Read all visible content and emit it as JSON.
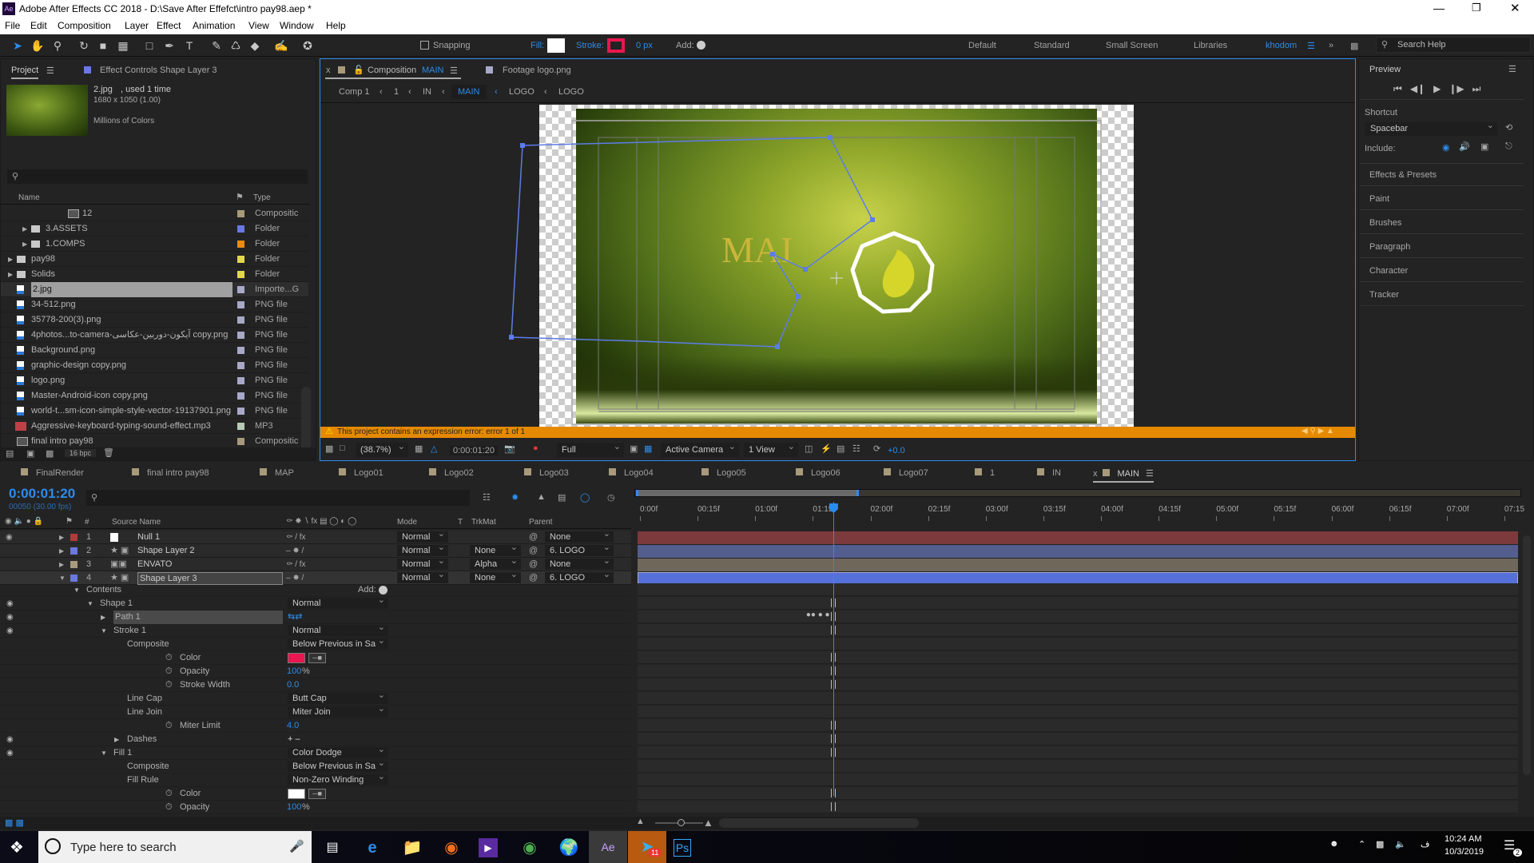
{
  "window": {
    "title": "Adobe After Effects CC 2018 - D:\\Save After Effefct\\intro pay98.aep *",
    "app_icon": "Ae"
  },
  "menu": [
    "File",
    "Edit",
    "Composition",
    "Layer",
    "Effect",
    "Animation",
    "View",
    "Window",
    "Help"
  ],
  "toolbar": {
    "snapping": "Snapping",
    "fill": "Fill:",
    "stroke": "Stroke:",
    "stroke_px": "0 px",
    "add": "Add:",
    "workspaces": [
      "Default",
      "Standard",
      "Small Screen",
      "Libraries",
      "khodom"
    ],
    "search_placeholder": "Search Help",
    "fill_color": "#ffffff",
    "stroke_color": "#e8174f"
  },
  "project": {
    "tab": "Project",
    "tab2": "Effect Controls Shape Layer 3",
    "preview": {
      "name": "2.jpg",
      "used": ", used 1 time",
      "size": "1680 x 1050 (1.00)",
      "colors": "Millions of Colors"
    },
    "col_name": "Name",
    "col_type": "Type",
    "bpc": "16 bpc",
    "items": [
      {
        "name": "12",
        "type": "Compositic",
        "label": "#a99a7c",
        "kind": "comp",
        "indent": 2
      },
      {
        "name": "3.ASSETS",
        "type": "Folder",
        "label": "#6a78e0",
        "kind": "folder",
        "indent": 1
      },
      {
        "name": "1.COMPS",
        "type": "Folder",
        "label": "#ee8a10",
        "kind": "folder",
        "indent": 1
      },
      {
        "name": "pay98",
        "type": "Folder",
        "label": "#e3d84a",
        "kind": "folder",
        "indent": 0
      },
      {
        "name": "Solids",
        "type": "Folder",
        "label": "#e3d84a",
        "kind": "folder",
        "indent": 0
      },
      {
        "name": "2.jpg",
        "type": "Importe...G",
        "label": "#a8a8c8",
        "kind": "image",
        "indent": 0,
        "selected": true
      },
      {
        "name": "34-512.png",
        "type": "PNG file",
        "label": "#a8a8c8",
        "kind": "image",
        "indent": 0
      },
      {
        "name": "35778-200(3).png",
        "type": "PNG file",
        "label": "#a8a8c8",
        "kind": "image",
        "indent": 0
      },
      {
        "name": "4photos...to-camera-آیکون-دوربین-عکاسی copy.png",
        "type": "PNG file",
        "label": "#a8a8c8",
        "kind": "image",
        "indent": 0
      },
      {
        "name": "Background.png",
        "type": "PNG file",
        "label": "#a8a8c8",
        "kind": "image",
        "indent": 0
      },
      {
        "name": "graphic-design copy.png",
        "type": "PNG file",
        "label": "#a8a8c8",
        "kind": "image",
        "indent": 0
      },
      {
        "name": "logo.png",
        "type": "PNG file",
        "label": "#a8a8c8",
        "kind": "image",
        "indent": 0
      },
      {
        "name": "Master-Android-icon copy.png",
        "type": "PNG file",
        "label": "#a8a8c8",
        "kind": "image",
        "indent": 0
      },
      {
        "name": "world-t...sm-icon-simple-style-vector-19137901.png",
        "type": "PNG file",
        "label": "#a8a8c8",
        "kind": "image",
        "indent": 0
      },
      {
        "name": "Aggressive-keyboard-typing-sound-effect.mp3",
        "type": "MP3",
        "label": "#b5cbb5",
        "kind": "audio",
        "indent": 0
      },
      {
        "name": "final intro pay98",
        "type": "Compositic",
        "label": "#a99a7c",
        "kind": "comp",
        "indent": 0
      }
    ]
  },
  "comp": {
    "tab": "Composition",
    "tab_name": "MAIN",
    "footage_tab": "Footage logo.png",
    "breadcrumb": [
      "Comp 1",
      "1",
      "IN",
      "MAIN",
      "LOGO",
      "LOGO"
    ],
    "viewer_text": "MAI",
    "error": "This project contains an expression error: error 1 of 1",
    "zoom": "(38.7%)",
    "time": "0:00:01:20",
    "resolution": "Full",
    "camera": "Active Camera",
    "views": "1 View",
    "exposure": "+0.0"
  },
  "preview": {
    "title": "Preview",
    "shortcut_label": "Shortcut",
    "shortcut": "Spacebar",
    "include": "Include:",
    "panels": [
      "Effects & Presets",
      "Paint",
      "Brushes",
      "Paragraph",
      "Character",
      "Tracker"
    ]
  },
  "timeline": {
    "tabs": [
      "FinalRender",
      "final intro pay98",
      "MAP",
      "Logo01",
      "Logo02",
      "Logo03",
      "Logo04",
      "Logo05",
      "Logo06",
      "Logo07",
      "1",
      "IN",
      "MAIN"
    ],
    "active_tab": "MAIN",
    "timecode": "0:00:01:20",
    "frames": "00050 (30.00 fps)",
    "headers": {
      "num": "#",
      "source": "Source Name",
      "mode": "Mode",
      "t": "T",
      "trkmat": "TrkMat",
      "parent": "Parent"
    },
    "ruler": [
      "0:00f",
      "00:15f",
      "01:00f",
      "01:15f",
      "02:00f",
      "02:15f",
      "03:00f",
      "03:15f",
      "04:00f",
      "04:15f",
      "05:00f",
      "05:15f",
      "06:00f",
      "06:15f",
      "07:00f",
      "07:15"
    ],
    "current_time_fraction": 0.2222,
    "work_area_end_fraction": 0.2533,
    "layers": [
      {
        "num": "1",
        "name": "Null 1",
        "label": "#b33a3a",
        "mode": "Normal",
        "trkmat": "",
        "parent": "None",
        "track": "#7d3a3c"
      },
      {
        "num": "2",
        "name": "Shape Layer 2",
        "label": "#6a78e0",
        "mode": "Normal",
        "trkmat": "None",
        "parent": "6. LOGO",
        "track": "#535e8e"
      },
      {
        "num": "3",
        "name": "ENVATO",
        "label": "#a99a7c",
        "mode": "Normal",
        "trkmat": "Alpha",
        "parent": "None",
        "track": "#6f675a"
      },
      {
        "num": "4",
        "name": "Shape Layer 3",
        "label": "#6a78e0",
        "mode": "Normal",
        "trkmat": "None",
        "parent": "6. LOGO",
        "track": "#5570d8",
        "selected": true
      }
    ],
    "add_label": "Add:",
    "properties": [
      {
        "name": "Contents",
        "indent": 0,
        "twirl": "open"
      },
      {
        "name": "Shape 1",
        "indent": 1,
        "twirl": "open",
        "eye": true,
        "dropdown": "Normal"
      },
      {
        "name": "Path 1",
        "indent": 2,
        "twirl": "closed",
        "eye": true,
        "highlight": true,
        "pathicons": true
      },
      {
        "name": "Stroke 1",
        "indent": 2,
        "twirl": "open",
        "eye": true,
        "dropdown": "Normal"
      },
      {
        "name": "Composite",
        "indent": 3,
        "dropdown": "Below Previous in Sa"
      },
      {
        "name": "Color",
        "indent": 3,
        "stopwatch": true,
        "swatch": "#e8174f"
      },
      {
        "name": "Opacity",
        "indent": 3,
        "stopwatch": true,
        "value": "100",
        "unit": " %"
      },
      {
        "name": "Stroke Width",
        "indent": 3,
        "stopwatch": true,
        "value": "0.0"
      },
      {
        "name": "Line Cap",
        "indent": 3,
        "dropdown": "Butt Cap"
      },
      {
        "name": "Line Join",
        "indent": 3,
        "dropdown": "Miter Join"
      },
      {
        "name": "Miter Limit",
        "indent": 3,
        "stopwatch": true,
        "value": "4.0"
      },
      {
        "name": "Dashes",
        "indent": 3,
        "twirl": "closed",
        "eye": true,
        "plusminus": true
      },
      {
        "name": "Fill 1",
        "indent": 2,
        "twirl": "open",
        "eye": true,
        "dropdown": "Color Dodge"
      },
      {
        "name": "Composite",
        "indent": 3,
        "dropdown": "Below Previous in Sa"
      },
      {
        "name": "Fill Rule",
        "indent": 3,
        "dropdown": "Non-Zero Winding"
      },
      {
        "name": "Color",
        "indent": 3,
        "stopwatch": true,
        "swatch": "#ffffff"
      },
      {
        "name": "Opacity",
        "indent": 3,
        "stopwatch": true,
        "value": "100",
        "unit": " %"
      }
    ]
  },
  "taskbar": {
    "search_placeholder": "Type here to search",
    "time": "10:24 AM",
    "date": "10/3/2019",
    "telegram_badge": "11",
    "notifications": "2",
    "apps": [
      "task-view",
      "edge",
      "file-explorer",
      "firefox",
      "media-player",
      "chrome",
      "maps",
      "after-effects",
      "telegram",
      "photoshop"
    ]
  }
}
